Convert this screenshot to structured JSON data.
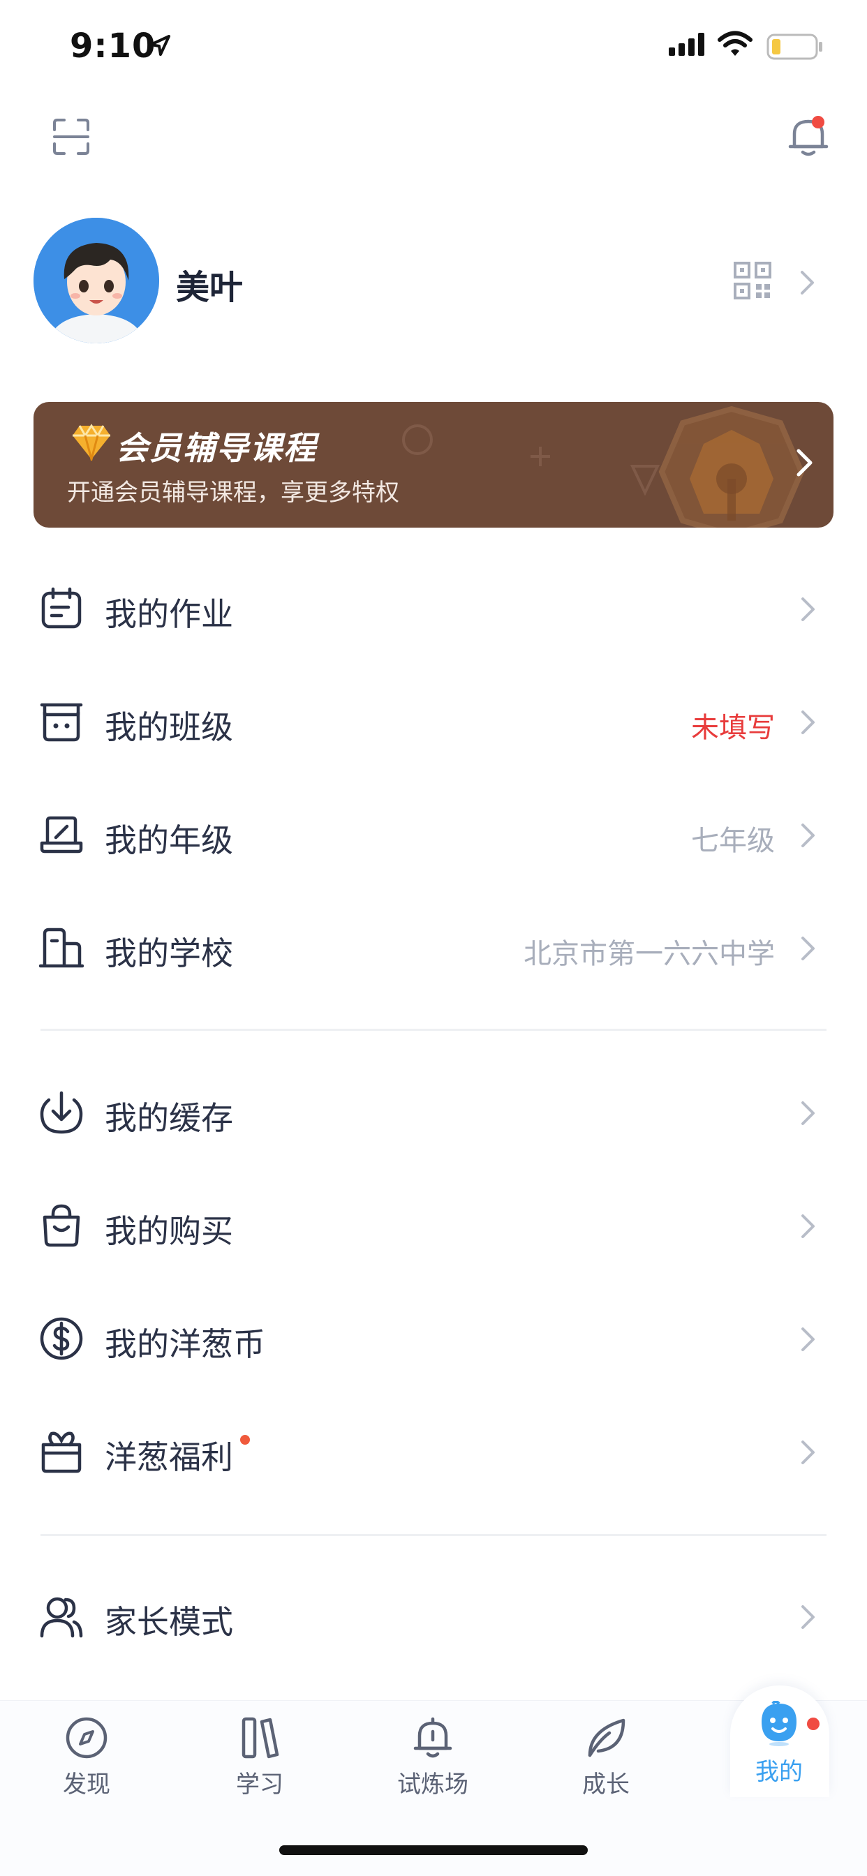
{
  "status_bar": {
    "time": "9:10"
  },
  "profile": {
    "username": "美叶"
  },
  "vip": {
    "title": "会员辅导课程",
    "subtitle": "开通会员辅导课程，享更多特权",
    "accent": "#6e4a38"
  },
  "menu_group1": [
    {
      "label": "我的作业",
      "value": "",
      "icon": "homework-icon"
    },
    {
      "label": "我的班级",
      "value": "未填写",
      "icon": "class-icon"
    },
    {
      "label": "我的年级",
      "value": "七年级",
      "icon": "grade-icon"
    },
    {
      "label": "我的学校",
      "value": "北京市第一六六中学",
      "icon": "school-icon"
    }
  ],
  "menu_group2": [
    {
      "label": "我的缓存",
      "icon": "download-icon"
    },
    {
      "label": "我的购买",
      "icon": "shopping-bag-icon"
    },
    {
      "label": "我的洋葱币",
      "icon": "coin-icon"
    },
    {
      "label": "洋葱福利",
      "icon": "gift-icon"
    }
  ],
  "menu_group3": [
    {
      "label": "家长模式",
      "icon": "parent-icon"
    }
  ],
  "tabbar": [
    {
      "label": "发现",
      "icon": "compass-icon"
    },
    {
      "label": "学习",
      "icon": "books-icon"
    },
    {
      "label": "试炼场",
      "icon": "arena-icon"
    },
    {
      "label": "成长",
      "icon": "leaf-icon"
    },
    {
      "label": "我的",
      "icon": "mascot-icon",
      "active": true
    }
  ],
  "colors": {
    "primary_text": "#2b3247",
    "muted": "#a8aebb",
    "warning": "#e83c3c",
    "active_tab": "#3aa0f0"
  }
}
